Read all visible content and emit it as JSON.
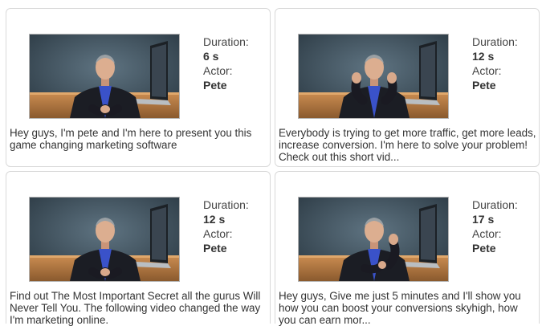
{
  "labels": {
    "duration": "Duration:",
    "actor": "Actor:"
  },
  "cards": [
    {
      "duration": "6 s",
      "actor": "Pete",
      "pose": "rest",
      "description": "Hey guys, I'm pete and I'm here to present you this  game changing marketing software"
    },
    {
      "duration": "12 s",
      "actor": "Pete",
      "pose": "hands-up",
      "description": "Everybody is trying to get more traffic, get more leads, increase conversion. I'm here to solve your problem! Check out this short vid..."
    },
    {
      "duration": "12 s",
      "actor": "Pete",
      "pose": "rest",
      "description": "Find out The Most Important Secret all the gurus Will Never Tell You. The following video changed the way I'm marketing online."
    },
    {
      "duration": "17 s",
      "actor": "Pete",
      "pose": "one-hand",
      "description": "Hey guys, Give me just 5 minutes and I'll show you how you can boost your conversions skyhigh, how you can earn mor..."
    }
  ]
}
